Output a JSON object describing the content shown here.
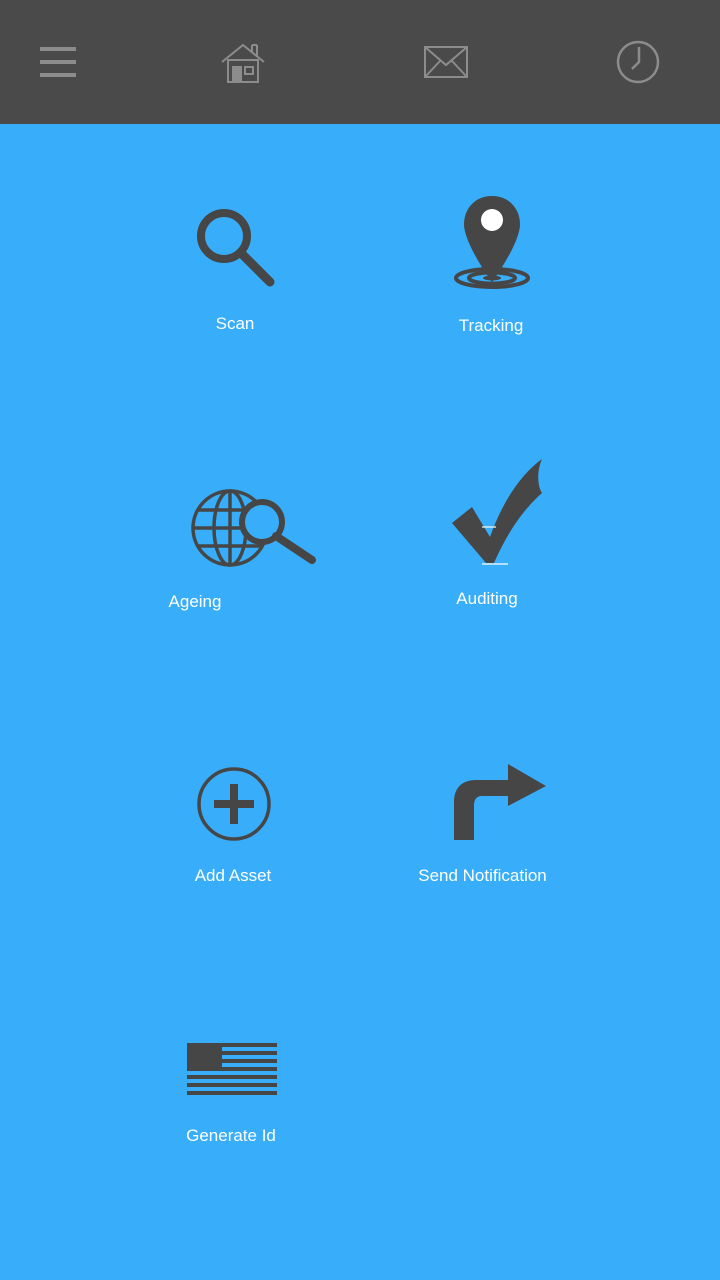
{
  "colors": {
    "background": "#38aefb",
    "topbar": "#4a4a4a",
    "icon_dark": "#464646",
    "topbar_icon": "#8c8c8c",
    "label": "#ffffff"
  },
  "topbar": {
    "icons": [
      "menu-icon",
      "home-icon",
      "mail-icon",
      "clock-icon"
    ]
  },
  "tiles": [
    {
      "label": "Scan",
      "icon": "magnifier-icon"
    },
    {
      "label": "Tracking",
      "icon": "location-pin-icon"
    },
    {
      "label": "Ageing",
      "icon": "globe-search-icon"
    },
    {
      "label": "Auditing",
      "icon": "checkmark-icon"
    },
    {
      "label": "Add Asset",
      "icon": "plus-circle-icon"
    },
    {
      "label": "Send Notification",
      "icon": "turn-right-arrow-icon"
    },
    {
      "label": "Generate Id",
      "icon": "flag-icon"
    }
  ]
}
